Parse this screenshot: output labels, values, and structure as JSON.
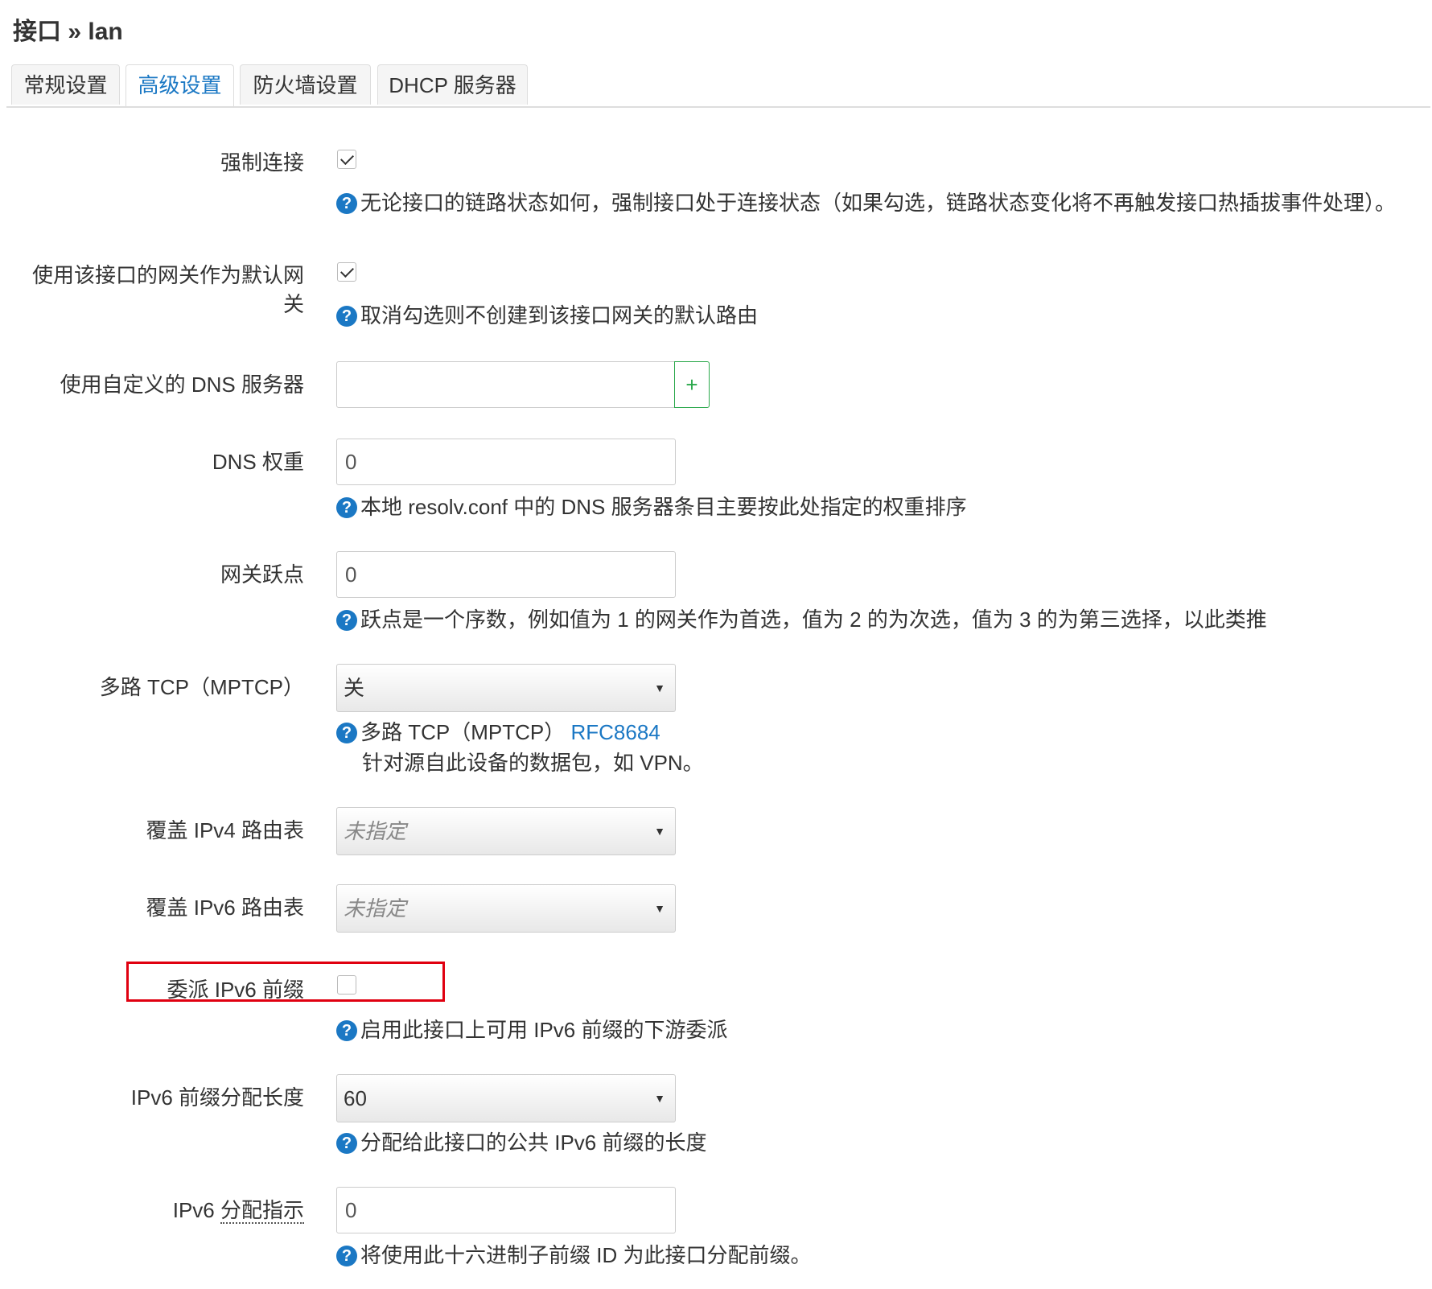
{
  "page": {
    "title": "接口 » lan"
  },
  "tabs": [
    {
      "label": "常规设置",
      "active": false
    },
    {
      "label": "高级设置",
      "active": true
    },
    {
      "label": "防火墙设置",
      "active": false
    },
    {
      "label": "DHCP 服务器",
      "active": false
    }
  ],
  "fields": {
    "force_link": {
      "label": "强制连接",
      "checked": true,
      "help": "无论接口的链路状态如何，强制接口处于连接状态（如果勾选，链路状态变化将不再触发接口热插拔事件处理）。"
    },
    "default_gateway": {
      "label_line1": "使用该接口的网关作为默认网",
      "label_line2": "关",
      "checked": true,
      "help": "取消勾选则不创建到该接口网关的默认路由"
    },
    "custom_dns": {
      "label": "使用自定义的 DNS 服务器",
      "value": "",
      "add_label": "+"
    },
    "dns_weight": {
      "label": "DNS 权重",
      "value": "0",
      "help": "本地 resolv.conf 中的 DNS 服务器条目主要按此处指定的权重排序"
    },
    "gateway_metric": {
      "label": "网关跃点",
      "value": "0",
      "help": "跃点是一个序数，例如值为 1 的网关作为首选，值为 2 的为次选，值为 3 的为第三选择，以此类推"
    },
    "mptcp": {
      "label": "多路 TCP（MPTCP）",
      "value": "关",
      "help_line1": "多路 TCP（MPTCP）",
      "help_link": "RFC8684",
      "help_line2": "针对源自此设备的数据包，如 VPN。"
    },
    "ipv4_table": {
      "label": "覆盖 IPv4 路由表",
      "value": "未指定"
    },
    "ipv6_table": {
      "label": "覆盖 IPv6 路由表",
      "value": "未指定"
    },
    "delegate": {
      "label": "委派 IPv6 前缀",
      "checked": false,
      "help": "启用此接口上可用 IPv6 前缀的下游委派",
      "highlight_color": "#e00010"
    },
    "ip6assign": {
      "label": "IPv6 前缀分配长度",
      "value": "60",
      "help": "分配给此接口的公共 IPv6 前缀的长度"
    },
    "ip6hint": {
      "label_prefix": "IPv6",
      "label_dotted": "分配指示",
      "value": "0",
      "help": "将使用此十六进制子前缀 ID 为此接口分配前缀。"
    }
  },
  "icons": {
    "help": "question-circle-icon",
    "caret": "caret-down-icon",
    "check": "check-icon"
  },
  "colors": {
    "accent": "#1b78c4",
    "add_button": "#2aa84b",
    "highlight": "#e00010"
  }
}
